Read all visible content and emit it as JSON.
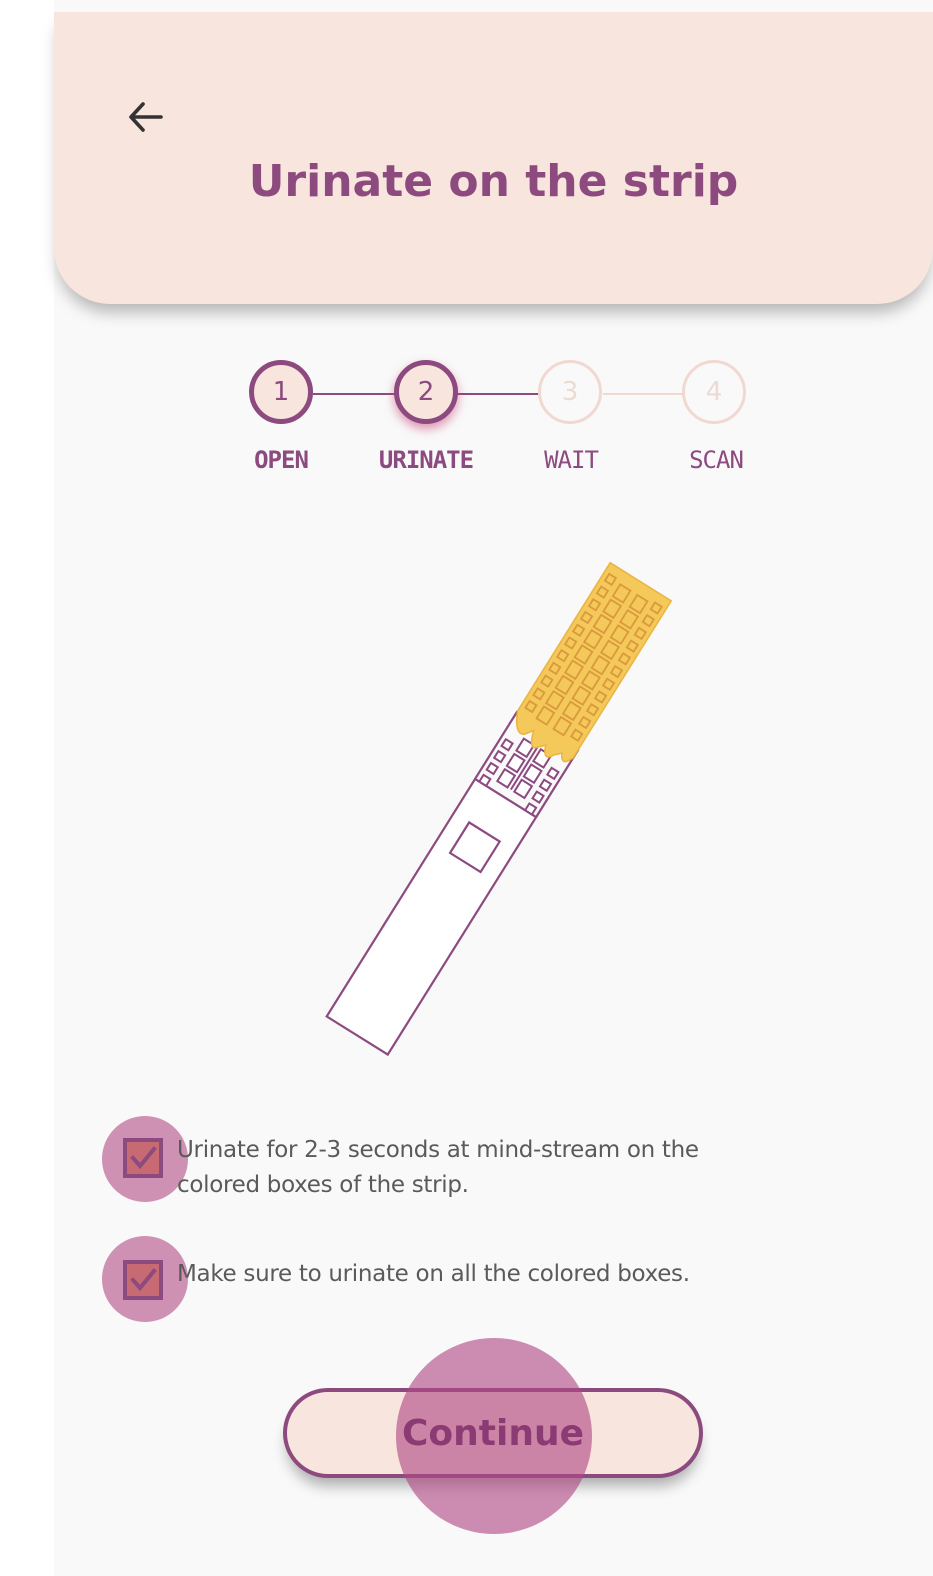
{
  "header": {
    "title": "Urinate on the strip",
    "back_icon": "arrow-left-icon"
  },
  "stepper": {
    "steps": [
      {
        "number": "1",
        "label": "OPEN",
        "state": "done"
      },
      {
        "number": "2",
        "label": "URINATE",
        "state": "active"
      },
      {
        "number": "3",
        "label": "WAIT",
        "state": "pending"
      },
      {
        "number": "4",
        "label": "SCAN",
        "state": "pending"
      }
    ]
  },
  "illustration": {
    "icon": "test-strip-illustration",
    "colors": {
      "outline": "#8c4a7f",
      "wet_area": "#f5c85a"
    }
  },
  "checklist": [
    {
      "text_line1": "Urinate for 2-3 seconds at mind-stream on the",
      "text_line2": "colored boxes of the strip.",
      "checked": true
    },
    {
      "text_line1": "Make sure to urinate on all the colored boxes.",
      "checked": true
    }
  ],
  "continue_button": {
    "label": "Continue"
  },
  "colors": {
    "brand": "#8c4a7f",
    "header_bg": "#f7e5de",
    "page_bg": "#f9f9f9",
    "checkbox_fill": "#c76a73",
    "highlight": "#b04984"
  }
}
